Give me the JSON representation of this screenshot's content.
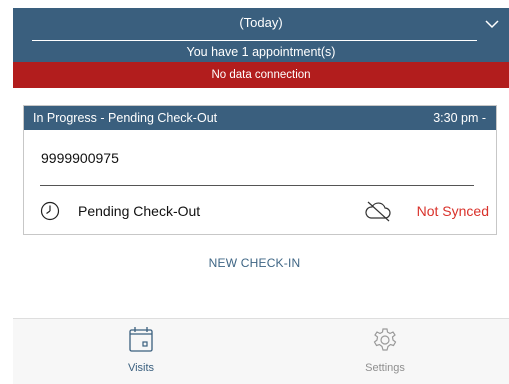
{
  "header": {
    "date_label": "(Today)",
    "appointments_text": "You have 1 appointment(s)"
  },
  "alert": {
    "text": "No data connection"
  },
  "visit_card": {
    "status": "In Progress - Pending Check-Out",
    "time": "3:30 pm -",
    "phone": "9999900975",
    "pending_label": "Pending Check-Out",
    "sync_status": "Not Synced"
  },
  "actions": {
    "new_checkin": "NEW CHECK-IN"
  },
  "tabs": [
    {
      "label": "Visits",
      "icon": "calendar-icon",
      "active": true
    },
    {
      "label": "Settings",
      "icon": "gear-icon",
      "active": false
    }
  ],
  "colors": {
    "primary": "#3a5f7e",
    "alert": "#b21d1d",
    "not_synced": "#d9322b",
    "inactive": "#8f8f8f"
  }
}
